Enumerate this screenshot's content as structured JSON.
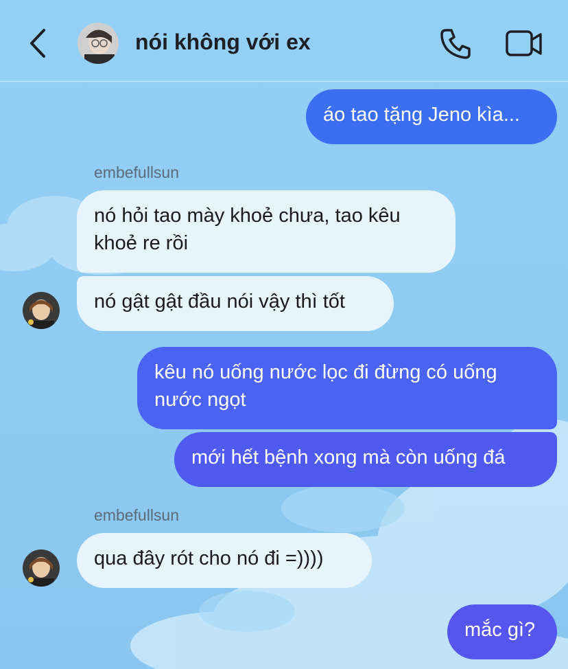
{
  "header": {
    "title": "nói không với ex",
    "back_icon": "chevron-left-icon",
    "call_icon": "phone-icon",
    "video_icon": "video-camera-icon"
  },
  "colors": {
    "background": "#92cdf3",
    "outgoing_blue": "#3b6ef0",
    "outgoing_violet": "#4f5af0",
    "incoming": "#e8f4fb",
    "title": "#1d1f24"
  },
  "messages": [
    {
      "from": "me",
      "text": "áo tao tặng Jeno kìa..."
    },
    {
      "sender_label": "embefullsun"
    },
    {
      "from": "embefullsun",
      "text": "nó hỏi tao mày khoẻ chưa, tao kêu khoẻ re rồi"
    },
    {
      "from": "embefullsun",
      "text": "nó gật gật đầu nói vậy thì tốt"
    },
    {
      "from": "me",
      "text": "kêu nó uống nước lọc đi đừng có uống nước ngọt"
    },
    {
      "from": "me",
      "text": "mới hết bệnh xong mà còn uống đá"
    },
    {
      "sender_label": "embefullsun"
    },
    {
      "from": "embefullsun",
      "text": "qua đây rót cho nó đi =))))"
    },
    {
      "from": "me",
      "text": "mắc gì?"
    }
  ]
}
